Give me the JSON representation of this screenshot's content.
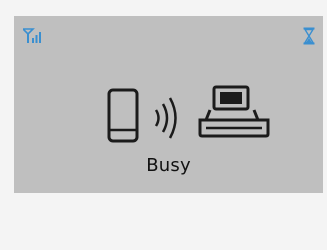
{
  "status": {
    "text": "Busy"
  },
  "icons": {
    "signal": "wifi-signal-icon",
    "busy": "hourglass-icon",
    "device": "phone-icon",
    "link": "wireless-waves-icon",
    "printer": "printer-icon"
  },
  "colors": {
    "accent_blue": "#3a8fd0",
    "panel_bg": "#bfbfbf",
    "page_bg": "#f4f4f4"
  }
}
